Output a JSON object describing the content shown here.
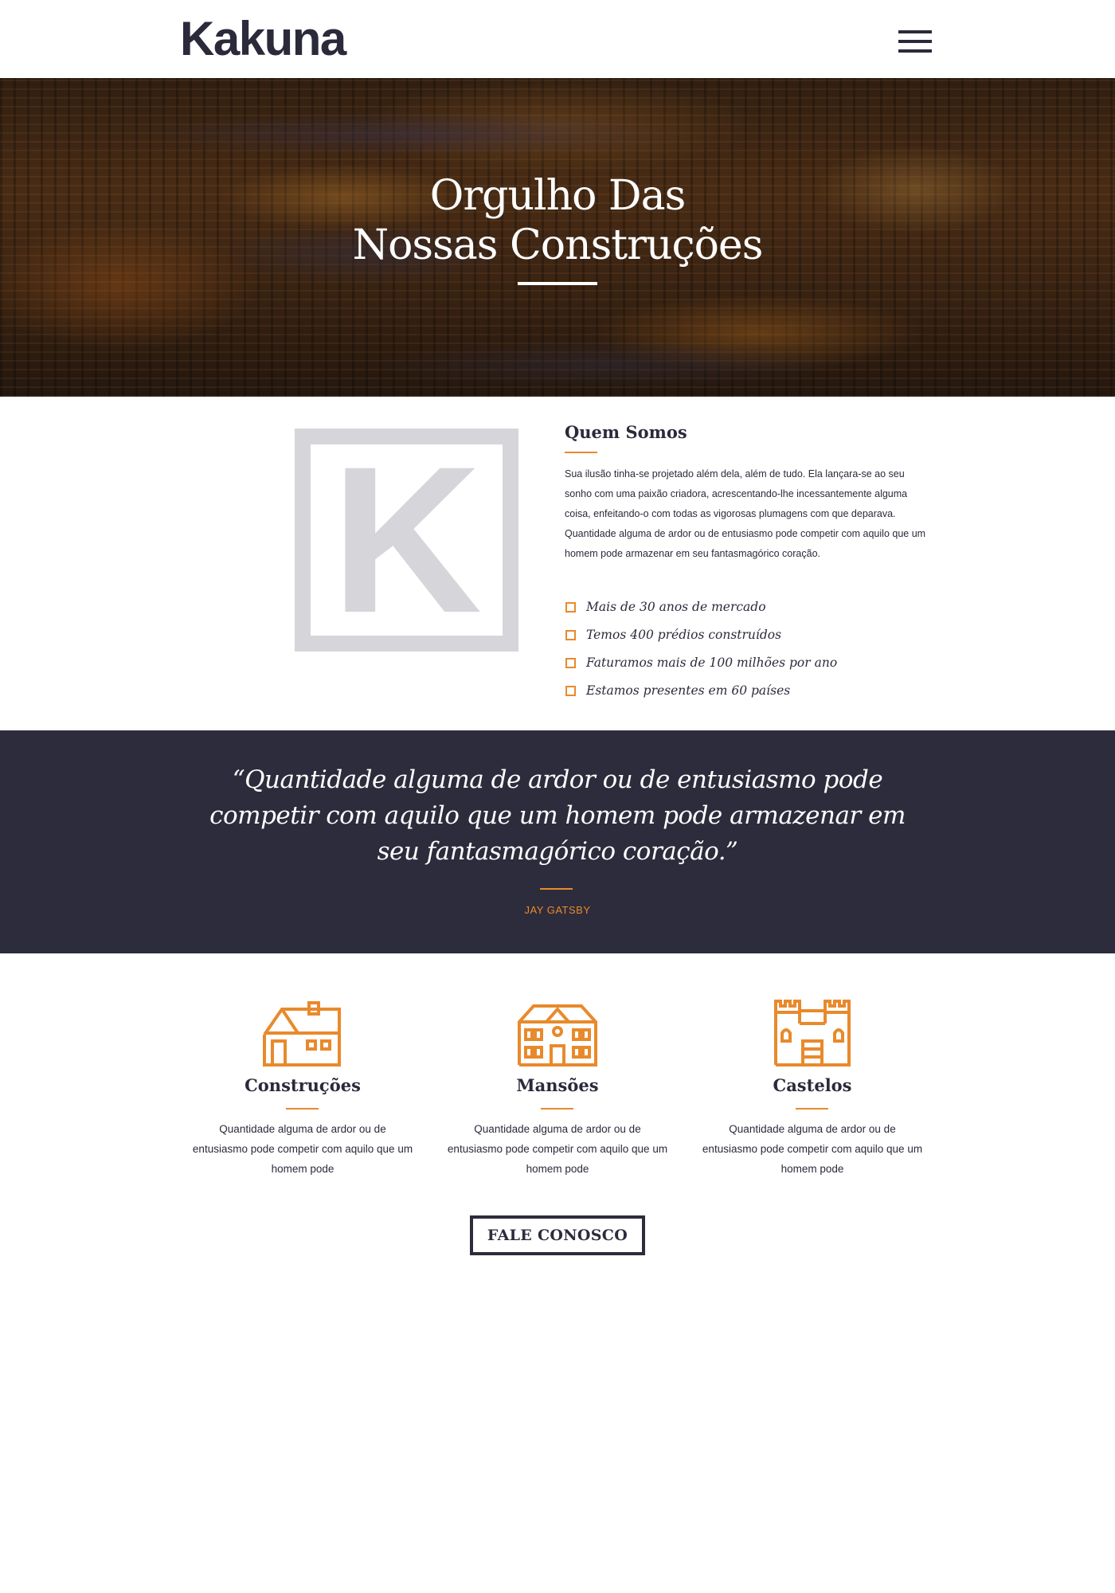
{
  "header": {
    "logo": "Kakuna",
    "menu_icon": "hamburger-menu-icon"
  },
  "hero": {
    "title_line1": "Orgulho Das",
    "title_line2": "Nossas Construções"
  },
  "about": {
    "logo_letter": "K",
    "title": "Quem Somos",
    "text": "Sua ilusão tinha-se projetado além dela, além de tudo. Ela lançara-se ao seu sonho com uma paixão criadora, acrescentando-lhe incessantemente alguma coisa, enfeitando-o com todas as vigorosas plumagens com que deparava. Quantidade alguma de ardor ou de entusiasmo pode competir com aquilo que um homem pode armazenar em seu fantasmagórico coração.",
    "features": [
      "Mais de 30 anos de mercado",
      "Temos 400 prédios construídos",
      "Faturamos mais de 100 milhões por ano",
      "Estamos presentes em 60 países"
    ]
  },
  "quote": {
    "text": "“Quantidade alguma de ardor ou de entusiasmo pode competir com aquilo que um homem pode armazenar em seu fantasmagórico coração.”",
    "author": "JAY GATSBY"
  },
  "services": [
    {
      "icon": "house-icon",
      "title": "Construções",
      "text": "Quantidade alguma de ardor ou de entusiasmo pode competir com aquilo que um homem pode"
    },
    {
      "icon": "mansion-icon",
      "title": "Mansões",
      "text": "Quantidade alguma de ardor ou de entusiasmo pode competir com aquilo que um homem pode"
    },
    {
      "icon": "castle-icon",
      "title": "Castelos",
      "text": "Quantidade alguma de ardor ou de entusiasmo pode competir com aquilo que um homem pode"
    }
  ],
  "cta": {
    "label": "FALE CONOSCO"
  },
  "colors": {
    "accent": "#e88a2c",
    "dark": "#2d2c3c",
    "light_gray": "#d6d5da"
  }
}
